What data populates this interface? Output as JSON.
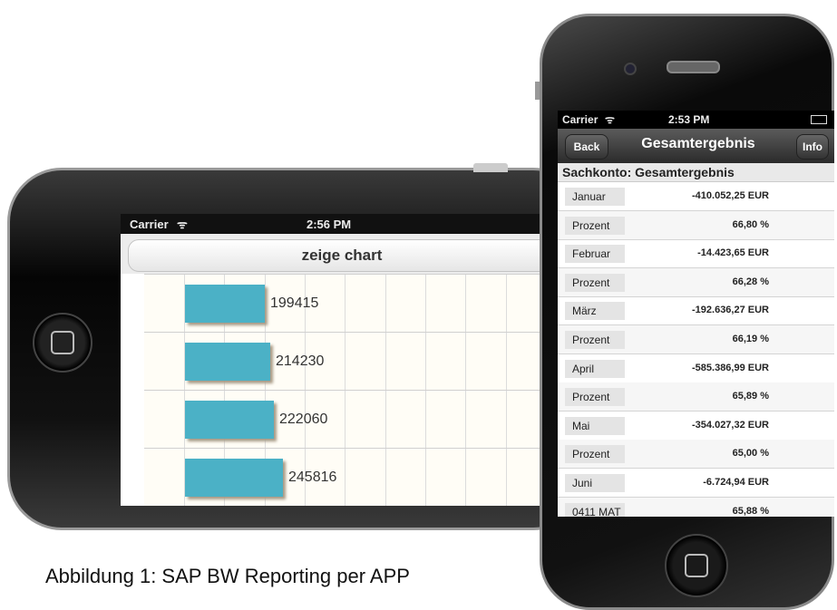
{
  "caption": "Abbildung 1: SAP BW Reporting per APP",
  "landscape": {
    "status": {
      "carrier": "Carrier",
      "wifi": "ᯤ",
      "time": "2:56 PM"
    },
    "button_label": "zeige chart",
    "chart_data": {
      "type": "bar",
      "values": [
        199415,
        214230,
        222060,
        245816
      ],
      "bar_color": "#4bb1c6"
    }
  },
  "portrait": {
    "status": {
      "carrier": "Carrier",
      "wifi": "ᯤ",
      "time": "2:53 PM"
    },
    "nav": {
      "back": "Back",
      "title": "Gesamtergebnis",
      "info": "Info"
    },
    "header": "Sachkonto: Gesamtergebnis",
    "rows": [
      {
        "label": "Januar",
        "value": "-410.052,25 EUR"
      },
      {
        "label": "Prozent",
        "value": "66,80 %"
      },
      {
        "label": "Februar",
        "value": "-14.423,65 EUR"
      },
      {
        "label": "Prozent",
        "value": "66,28 %"
      },
      {
        "label": "März",
        "value": "-192.636,27 EUR"
      },
      {
        "label": "Prozent",
        "value": "66,19 %"
      },
      {
        "label": "April",
        "value": "-585.386,99 EUR"
      },
      {
        "label": "Prozent",
        "value": "65,89 %"
      },
      {
        "label": "Mai",
        "value": "-354.027,32 EUR"
      },
      {
        "label": "Prozent",
        "value": "65,00 %"
      },
      {
        "label": "Juni",
        "value": "-6.724,94 EUR"
      },
      {
        "label": "0411 MAT",
        "value": "65,88 %"
      }
    ]
  }
}
